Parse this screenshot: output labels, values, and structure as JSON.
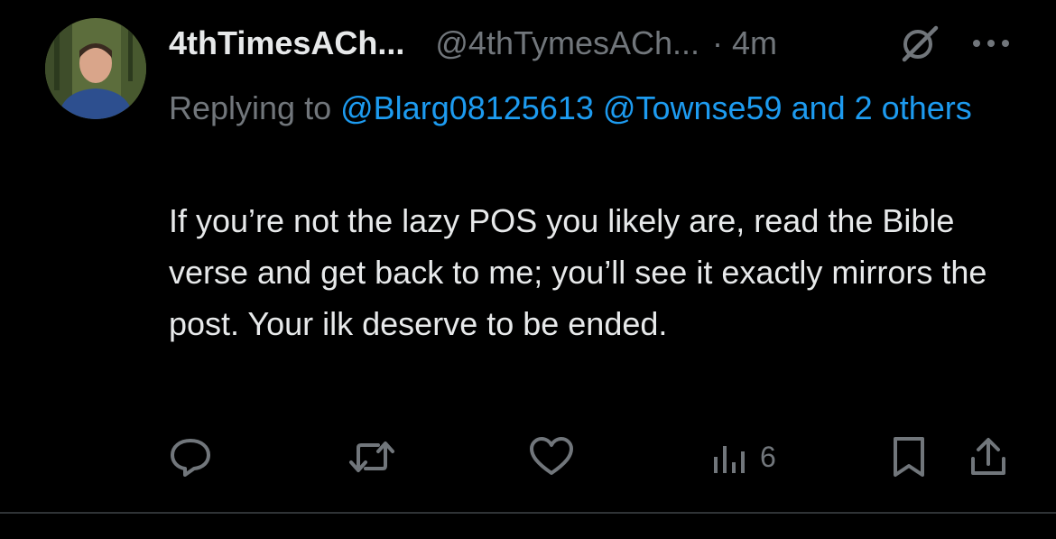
{
  "tweet": {
    "author": {
      "display_name": "4thTimesACh...",
      "handle": "@4thTymesACh...",
      "separator": "·",
      "timestamp": "4m"
    },
    "reply": {
      "prefix": "Replying to",
      "mention_1": "@Blarg08125613",
      "mention_2": "@Townse59",
      "and_others": "and 2 others"
    },
    "text": "If you’re not the lazy POS you likely are, read the Bible verse and get back to me; you’ll see it exactly mirrors the post. Your ilk deserve to be ended.",
    "actions": {
      "reply_icon": "reply-icon",
      "retweet_icon": "retweet-icon",
      "like_icon": "heart-icon",
      "views_icon": "views-icon",
      "views_count": "6",
      "bookmark_icon": "bookmark-icon",
      "share_icon": "share-icon"
    }
  },
  "colors": {
    "background": "#000000",
    "primary_text": "#e7e9ea",
    "secondary_text": "#71767b",
    "link": "#1d9bf0",
    "divider": "#2f3336"
  }
}
